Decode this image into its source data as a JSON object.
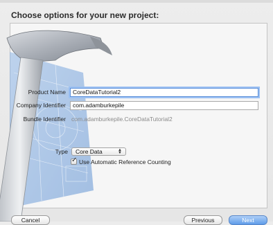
{
  "header": {
    "title": "Choose options for your new project:"
  },
  "form": {
    "product_name": {
      "label": "Product Name",
      "value": "CoreDataTutorial2"
    },
    "company_identifier": {
      "label": "Company Identifier",
      "value": "com.adamburkepile"
    },
    "bundle_identifier": {
      "label": "Bundle Identifier",
      "value": "com.adamburkepile.CoreDataTutorial2"
    },
    "type": {
      "label": "Type",
      "value": "Core Data"
    },
    "arc": {
      "label": "Use Automatic Reference Counting",
      "checked": true
    }
  },
  "buttons": {
    "cancel": "Cancel",
    "previous": "Previous",
    "next": "Next"
  },
  "colors": {
    "accent": "#5b8fd9",
    "panel": "#f6f6f6",
    "blueprint": "#6f9fd8"
  },
  "icons": {
    "background_art": "xcode-hammer-blueprint-icon",
    "popup_arrows": "chevron-up-down-icon",
    "checkmark": "checkmark-icon"
  }
}
